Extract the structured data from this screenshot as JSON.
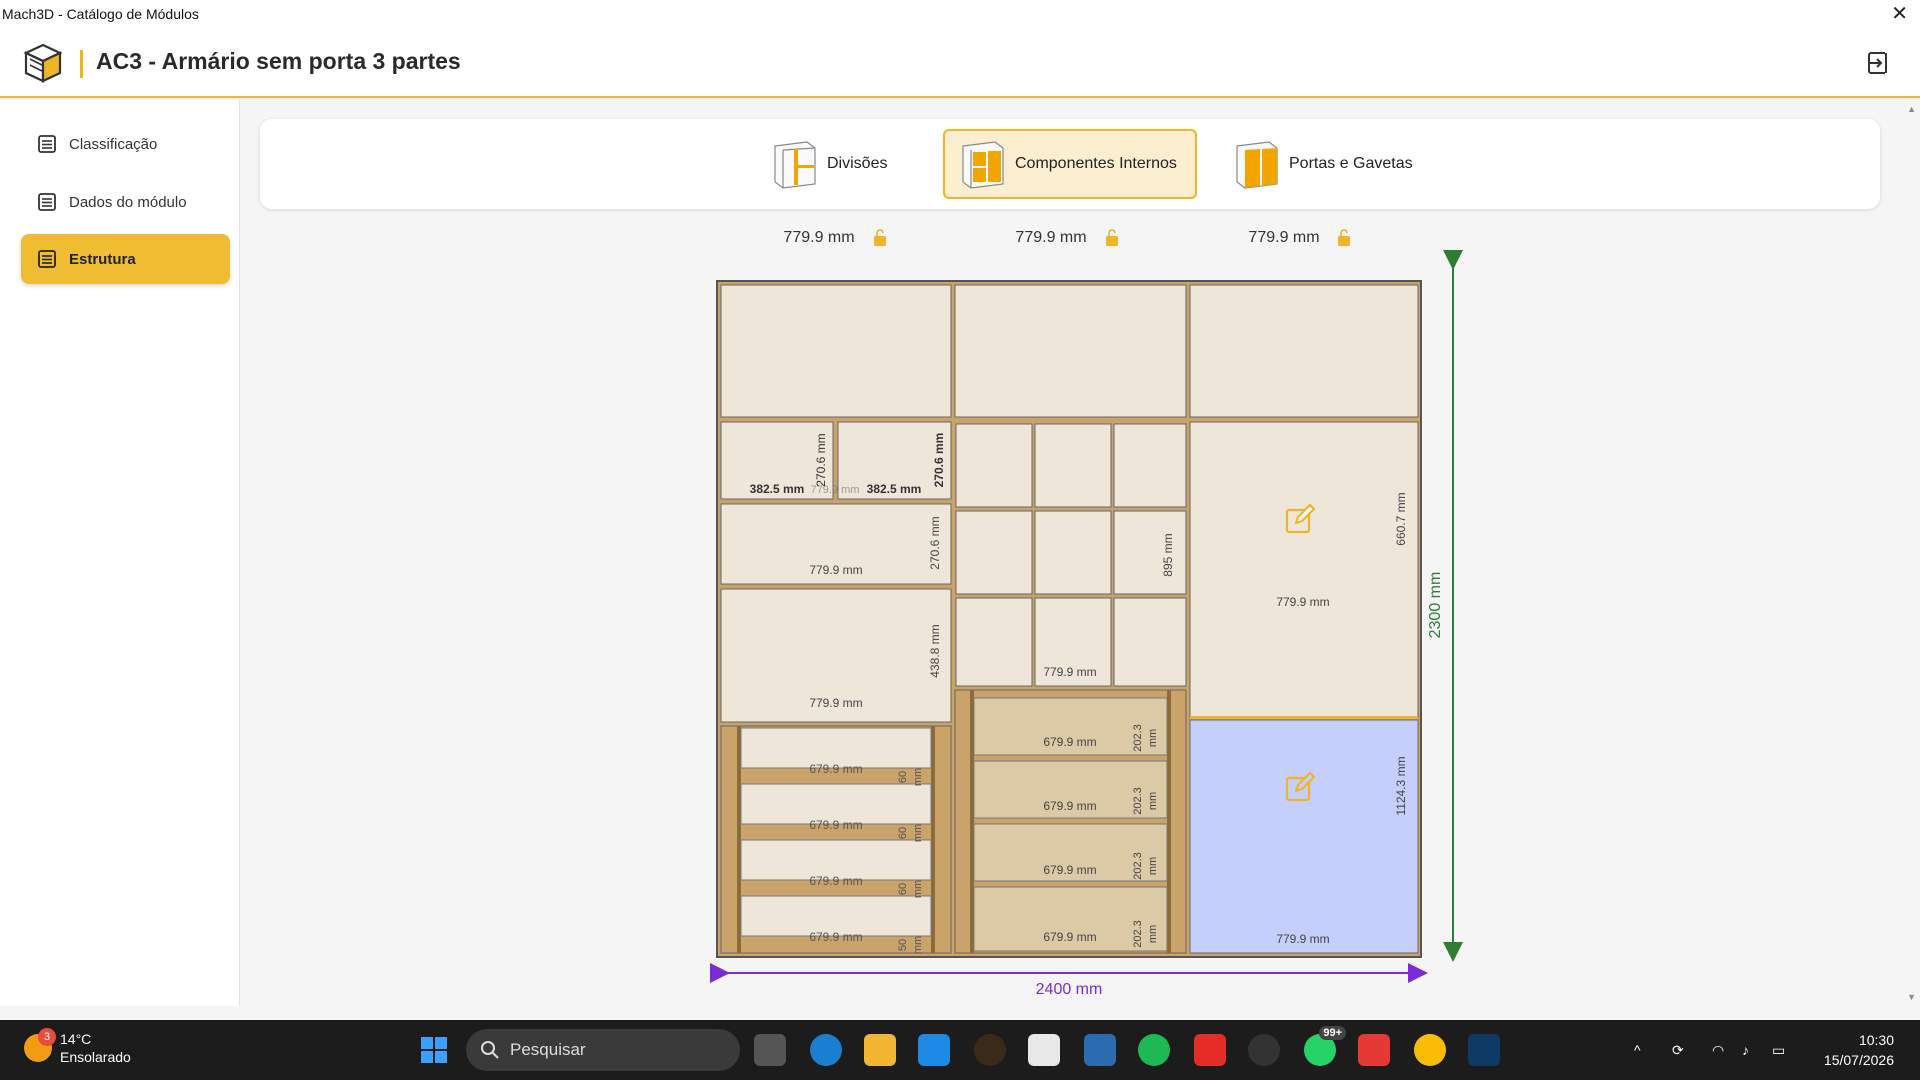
{
  "window": {
    "title": "Mach3D - Catálogo de Módulos"
  },
  "header": {
    "title": "AC3 - Armário sem porta 3 partes"
  },
  "sidebar": {
    "items": [
      {
        "label": "Classificação",
        "icon": "list-icon"
      },
      {
        "label": "Dados do módulo",
        "icon": "list-icon"
      },
      {
        "label": "Estrutura",
        "icon": "list-icon",
        "active": true
      }
    ]
  },
  "tabs": [
    {
      "label": "Divisões"
    },
    {
      "label": "Componentes Internos",
      "active": true
    },
    {
      "label": "Portas e Gavetas"
    }
  ],
  "drawing": {
    "top_widths": [
      "779.9 mm",
      "779.9 mm",
      "779.9 mm"
    ],
    "total_width": "2400 mm",
    "total_height": "2300 mm",
    "left_col": {
      "niche_w1": "382.5 mm",
      "niche_w2": "382.5 mm",
      "niche_gap": "779.9 mm",
      "niche_h1": "270.6 mm",
      "niche_h2": "270.6 mm",
      "shelf1_w": "779.9 mm",
      "shelf1_h": "270.6 mm",
      "shelf2_w": "779.9 mm",
      "shelf2_h": "438.8 mm",
      "drawer_w": "679.9 mm",
      "drawer_h": "60",
      "drawer_unit": "mm",
      "drawer_last_h": "50"
    },
    "mid_col": {
      "grid_w": "779.9 mm",
      "grid_h": "895 mm",
      "drawer_w": "679.9 mm",
      "drawer_h": "202.3",
      "drawer_unit": "mm"
    },
    "right_col": {
      "upper_w": "779.9 mm",
      "upper_h": "660.7 mm",
      "lower_w": "779.9 mm",
      "lower_h": "1124.3 mm"
    }
  },
  "taskbar": {
    "weather_temp": "14°C",
    "weather_desc": "Ensolarado",
    "weather_badge": "3",
    "search_placeholder": "Pesquisar",
    "whatsapp_badge": "99+",
    "time": "10:30",
    "date": "15/07/2026"
  },
  "colors": {
    "accent": "#f0b429",
    "panel": "#efe6da",
    "wood": "#c9a36a",
    "selected_area": "#c5cffb",
    "height_arrow": "#2e7d32",
    "width_arrow": "#7b2cd6"
  }
}
